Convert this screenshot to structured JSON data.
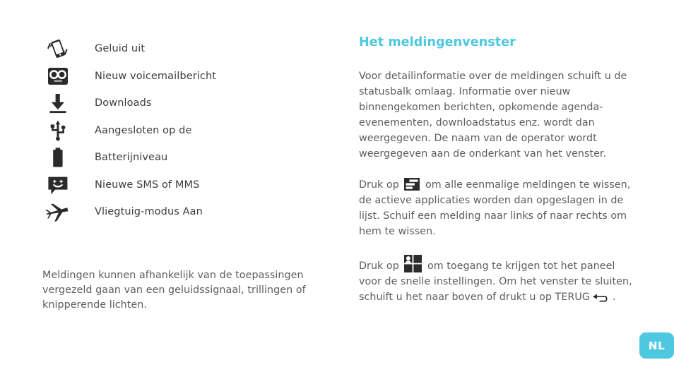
{
  "left_column": {
    "icon_list": [
      {
        "icon": "vibrate-phone-icon",
        "label": "Geluid uit"
      },
      {
        "icon": "voicemail-icon",
        "label": "Nieuw voicemailbericht"
      },
      {
        "icon": "download-icon",
        "label": "Downloads"
      },
      {
        "icon": "usb-icon",
        "label": "Aangesloten op de"
      },
      {
        "icon": "battery-icon",
        "label": "Batterijniveau"
      },
      {
        "icon": "sms-message-icon",
        "label": "Nieuwe SMS of MMS"
      },
      {
        "icon": "airplane-mode-icon",
        "label": "Vliegtuig-modus Aan"
      }
    ],
    "note": "Meldingen kunnen afhankelijk van de toepassingen vergezeld gaan van een geluidssignaal, trillingen of knipperende lichten."
  },
  "right_column": {
    "heading": "Het meldingenvenster",
    "paragraph_1": "Voor detailinformatie over de meldingen schuift u de statusbalk omlaag. Informatie over nieuw binnengekomen berichten, opkomende agenda-evenementen, downloadstatus enz. wordt dan weergegeven. De naam van de operator wordt weergegeven aan de onderkant van het venster.",
    "paragraph_2": {
      "before_icon": "Druk op",
      "icon": "clear-notifications-icon",
      "after_icon": "om alle eenmalige meldingen te wissen, de actieve applicaties worden dan opgeslagen in de lijst. Schuif een melding naar links of naar rechts om hem te wissen."
    },
    "paragraph_3": {
      "before_icon": "Druk op",
      "icon": "quick-settings-grid-icon",
      "after_icon": "om toegang te krijgen tot het paneel voor de snelle instellingen. Om het venster te sluiten, schuift u het naar boven of drukt u op TERUG",
      "end_icon": "back-arrow-icon",
      "trailing": "."
    }
  },
  "language_badge": {
    "label": "NL"
  },
  "colors": {
    "accent": "#4ec8e0",
    "body_text": "#5c5d5f",
    "list_text": "#3d3d3f",
    "icon_dark": "#2b2b2d",
    "page_background": "#ffffff"
  }
}
